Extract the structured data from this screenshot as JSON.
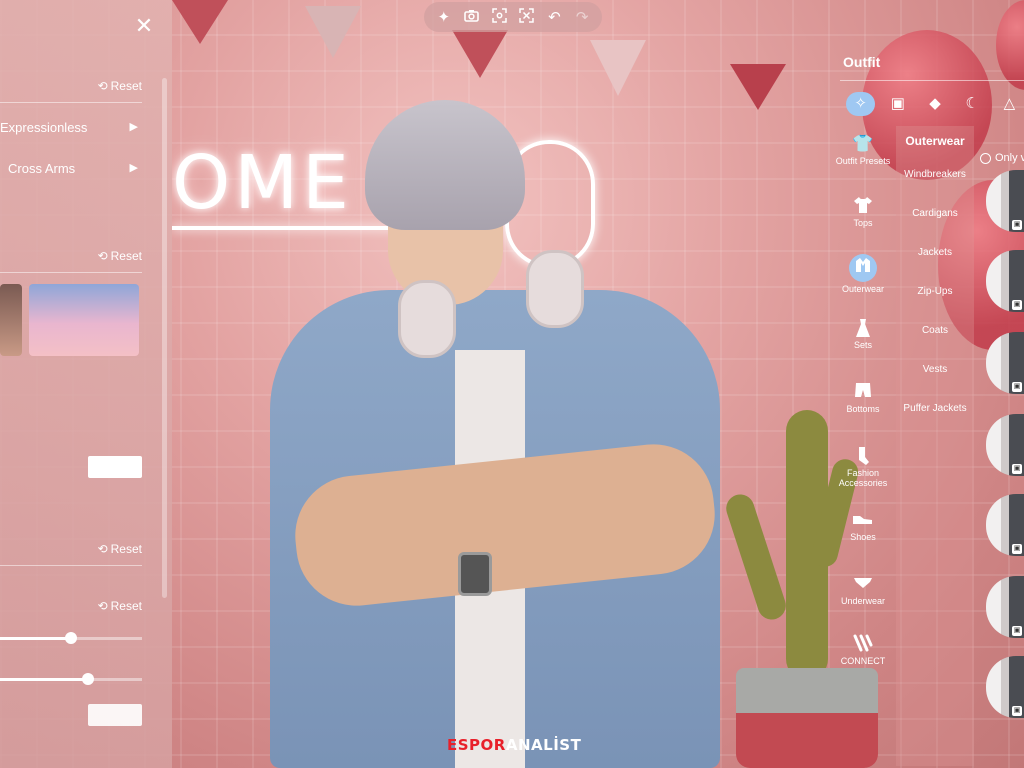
{
  "toolbar": {
    "icons": [
      "sparkle-icon",
      "camera-icon",
      "focus-icon",
      "screenshot-icon",
      "undo-icon",
      "redo-icon"
    ]
  },
  "left_panel": {
    "reset_label": "Reset",
    "expression_value": "Expressionless",
    "pose_value": "Cross Arms",
    "slider1_percent": 50,
    "slider2_percent": 62
  },
  "scene": {
    "neon_text": "OME"
  },
  "right_panel": {
    "title": "Outfit",
    "categories": [
      {
        "label": "Outfit Presets",
        "icon": "preset-icon"
      },
      {
        "label": "Tops",
        "icon": "tshirt-icon"
      },
      {
        "label": "Outerwear",
        "icon": "jacket-icon"
      },
      {
        "label": "Sets",
        "icon": "dress-icon"
      },
      {
        "label": "Bottoms",
        "icon": "shorts-icon"
      },
      {
        "label": "Fashion Accessories",
        "icon": "sock-icon"
      },
      {
        "label": "Shoes",
        "icon": "shoe-icon"
      },
      {
        "label": "Underwear",
        "icon": "underwear-icon"
      },
      {
        "label": "CONNECT",
        "icon": "connect-icon"
      }
    ],
    "subcategory_title": "Outerwear",
    "subcategories": [
      "Windbreakers",
      "Cardigans",
      "Jackets",
      "Zip-Ups",
      "Coats",
      "Vests",
      "Puffer Jackets"
    ],
    "only_label": "Only v"
  },
  "watermark": {
    "part1": "ESPOR",
    "part2": "ANALİST"
  },
  "colors": {
    "accent": "#9fc8f2",
    "panel": "#e2b2b0",
    "watermark_red": "#e8202a"
  }
}
